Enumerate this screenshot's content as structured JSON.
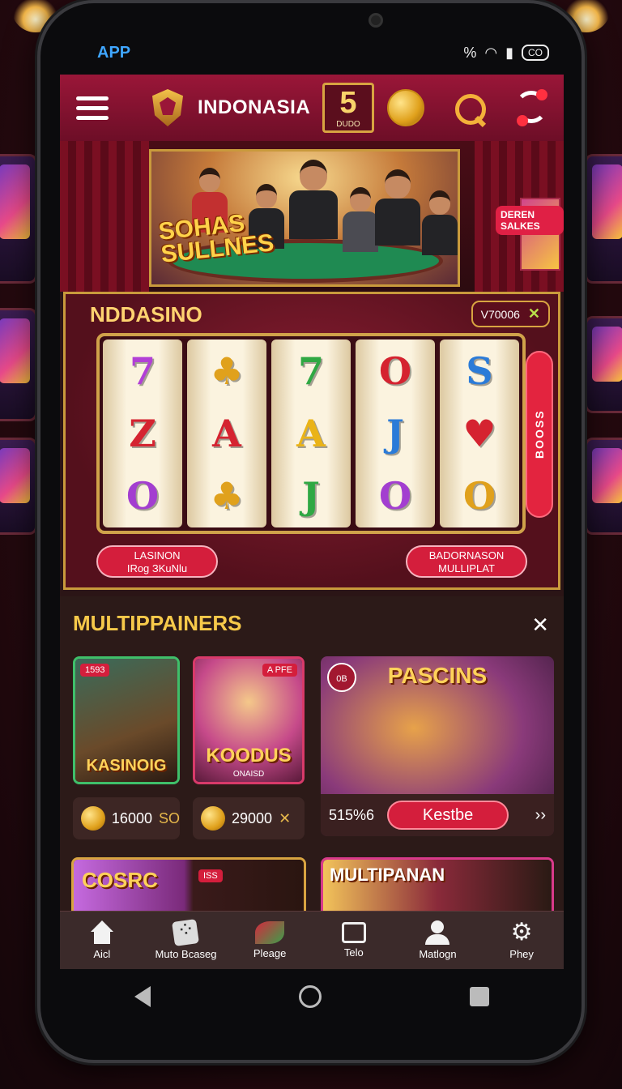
{
  "status": {
    "app_label": "APP",
    "percent": "%",
    "battery": "CO"
  },
  "header": {
    "brand": "INDONASIA",
    "lotto_number": "5",
    "lotto_sub": "DUDO"
  },
  "hero": {
    "title": "SOHAS SULLNES",
    "side_sign": "DEREN SALKES"
  },
  "slot": {
    "title": "NDDASINO",
    "badge_value": "V70006",
    "badge_icon": "✕",
    "boost_label": "BOOSS",
    "reels": [
      [
        {
          "s": "7",
          "c": "#b23fd6"
        },
        {
          "s": "Z",
          "c": "#d52330"
        },
        {
          "s": "O",
          "c": "#a33ed0"
        }
      ],
      [
        {
          "s": "♣",
          "c": "#e0a11c"
        },
        {
          "s": "A",
          "c": "#d52330"
        },
        {
          "s": "♣",
          "c": "#e0a11c"
        }
      ],
      [
        {
          "s": "7",
          "c": "#2fa843"
        },
        {
          "s": "A",
          "c": "#eab317"
        },
        {
          "s": "J",
          "c": "#2fa843"
        }
      ],
      [
        {
          "s": "O",
          "c": "#d52330"
        },
        {
          "s": "J",
          "c": "#2b7bd8"
        },
        {
          "s": "O",
          "c": "#a33ed0"
        }
      ],
      [
        {
          "s": "S",
          "c": "#2b7bd8"
        },
        {
          "s": "♥",
          "c": "#d52330"
        },
        {
          "s": "O",
          "c": "#e0a11c"
        }
      ]
    ],
    "btn_left_line1": "LASINON",
    "btn_left_line2": "IRog ЗKuNlu",
    "btn_right_line1": "BADORNASON",
    "btn_right_line2": "MULLIPLAT"
  },
  "multi": {
    "title": "MULTIPPAINERS",
    "close_icon": "✕",
    "card1": {
      "tag": "1593",
      "label": "KASINOIG"
    },
    "card2": {
      "tag": "A PFE",
      "label": "KOODUS",
      "sub": "ONAISD"
    },
    "card3": {
      "tag": "0B",
      "label": "PASCINS"
    },
    "price1": {
      "value": "16000",
      "suffix": "SO"
    },
    "price2": {
      "value": "29000",
      "suffix": "✕"
    },
    "feature": {
      "percent": "515%6",
      "button": "Kestbe",
      "next": "››"
    },
    "card4": {
      "label": "COSRC",
      "tag": "ISS"
    },
    "card5": {
      "label": "MULTIPANAN"
    }
  },
  "nav": [
    {
      "label": "Aicl"
    },
    {
      "label": "Muto Bcaseg"
    },
    {
      "label": "Pleage"
    },
    {
      "label": "Telo"
    },
    {
      "label": "Matlogn"
    },
    {
      "label": "Phey"
    }
  ],
  "colors": {
    "accent": "#d41e3c",
    "gold": "#f6c94a",
    "header": "#9a1638"
  }
}
